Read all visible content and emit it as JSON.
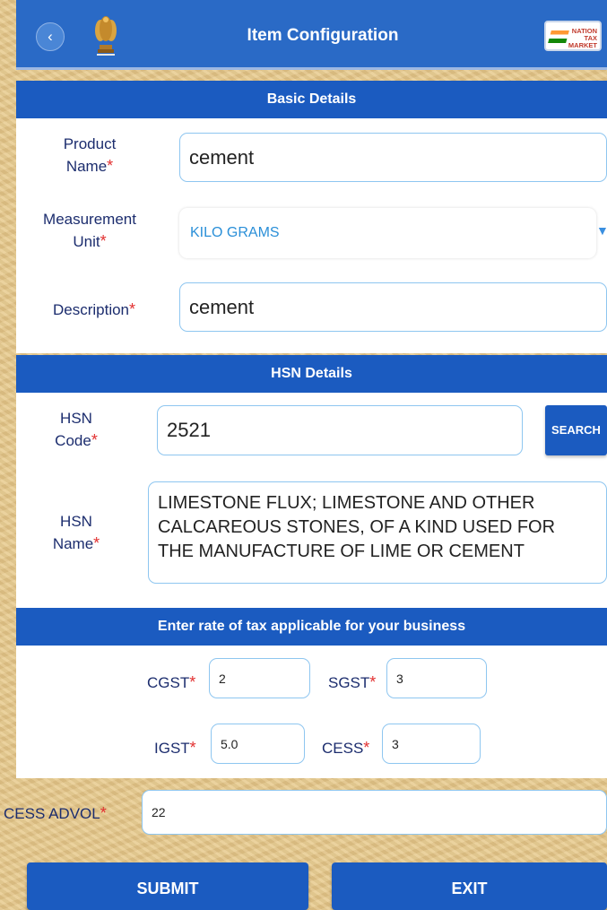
{
  "header": {
    "title": "Item Configuration",
    "back_icon": "chevron-left-icon",
    "emblem_icon": "national-emblem-icon",
    "logo_text": [
      "NATION",
      "TAX",
      "MARKET"
    ]
  },
  "basic_details": {
    "section_title": "Basic Details",
    "product_name": {
      "label_line1": "Product",
      "label_line2": "Name",
      "value": "cement"
    },
    "measurement_unit": {
      "label_line1": "Measurement",
      "label_line2": "Unit",
      "value": "KILO GRAMS"
    },
    "description": {
      "label": "Description",
      "value": "cement"
    }
  },
  "hsn_details": {
    "section_title": "HSN Details",
    "hsn_code": {
      "label_line1": "HSN",
      "label_line2": "Code",
      "value": "2521"
    },
    "search_button": "SEARCH",
    "hsn_name": {
      "label_line1": "HSN",
      "label_line2": "Name",
      "value_lines": [
        "LIMESTONE FLUX; LIMESTONE AND OTHER",
        "CALCAREOUS STONES, OF A KIND USED FOR",
        "THE MANUFACTURE OF LIME OR CEMENT"
      ]
    }
  },
  "tax": {
    "section_title": "Enter rate of tax applicable for your business",
    "cgst": {
      "label": "CGST",
      "value": "2"
    },
    "sgst": {
      "label": "SGST",
      "value": "3"
    },
    "igst": {
      "label": "IGST",
      "value": "5.0"
    },
    "cess": {
      "label": "CESS",
      "value": "3"
    },
    "cess_advol": {
      "label": "CESS ADVOL",
      "value": "22"
    }
  },
  "required_mark": "*",
  "actions": {
    "submit": "SUBMIT",
    "exit": "EXIT"
  },
  "colors": {
    "primary": "#1b5bc0",
    "header": "#2a6ac6",
    "label": "#1c2d6e",
    "required": "#e23030",
    "input_border": "#8ec6f0",
    "background": "#e6c98d"
  }
}
